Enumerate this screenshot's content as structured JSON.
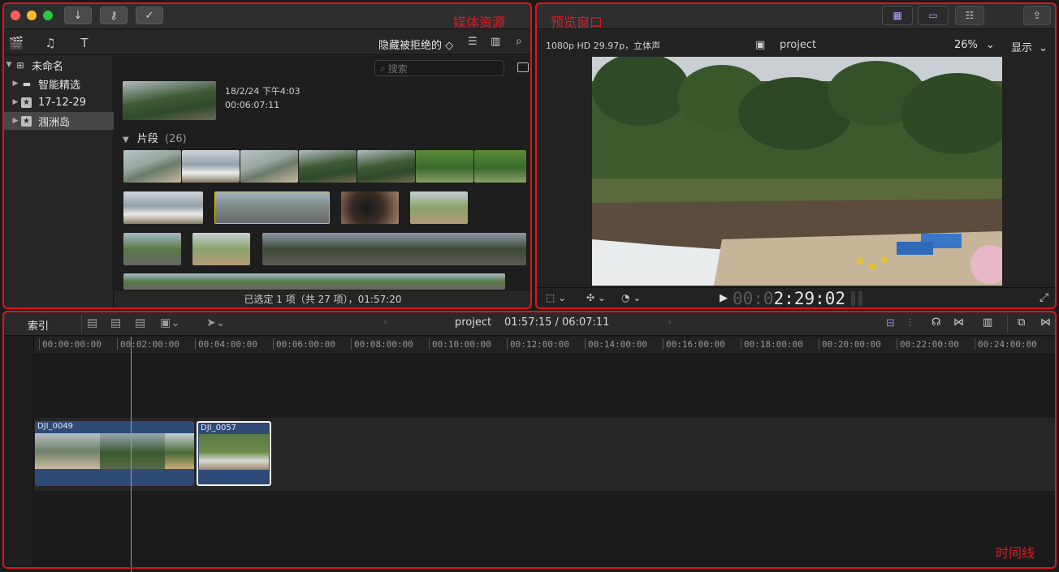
{
  "annotations": {
    "browser": "媒体资源",
    "viewer": "预览窗口",
    "timeline": "时间线"
  },
  "browser": {
    "filter_label": "隐藏被拒绝的 ◇",
    "sidebar": [
      {
        "label": "未命名",
        "icon": "library-icon"
      },
      {
        "label": "智能精选",
        "icon": "folder-icon"
      },
      {
        "label": "17-12-29",
        "icon": "event-star-icon"
      },
      {
        "label": "涠洲岛",
        "icon": "event-star-icon"
      }
    ],
    "search_placeholder": "搜索",
    "header_clip": {
      "date": "18/2/24 下午4:03",
      "duration": "00:06:07:11"
    },
    "section_title": "片段",
    "section_count": "(26)",
    "status": "已选定 1 项（共 27 项），01:57:20"
  },
  "viewer": {
    "format": "1080p HD 29.97p，立体声",
    "project": "project",
    "zoom": "26%",
    "display": "显示",
    "timecode_dim": "00:0",
    "timecode": "2:29:02"
  },
  "timeline": {
    "index_label": "索引",
    "project": "project",
    "position": "01:57:15 / 06:07:11",
    "ruler": [
      "00:00:00:00",
      "00:02:00:00",
      "00:04:00:00",
      "00:06:00:00",
      "00:08:00:00",
      "00:10:00:00",
      "00:12:00:00",
      "00:14:00:00",
      "00:16:00:00",
      "00:18:00:00",
      "00:20:00:00",
      "00:22:00:00",
      "00:24:00:00"
    ],
    "clips": [
      {
        "name": "DJI_0049"
      },
      {
        "name": "DJI_0057"
      }
    ]
  }
}
